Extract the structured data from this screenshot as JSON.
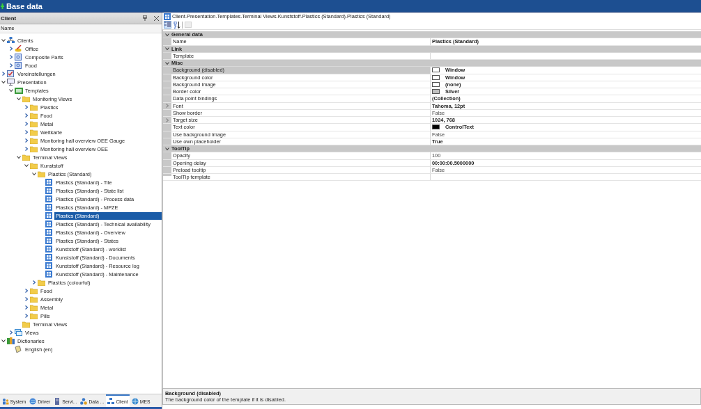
{
  "window": {
    "title": "Base data"
  },
  "left_panel": {
    "title": "Client",
    "column_header": "Name",
    "tree": [
      {
        "label": "Clients",
        "kind": "group",
        "expanded": true,
        "selected": false,
        "children": [
          {
            "label": "Office",
            "kind": "office",
            "expanded": false,
            "selected": false
          },
          {
            "label": "Composite Parts",
            "kind": "part",
            "expanded": false,
            "selected": false
          },
          {
            "label": "Food",
            "kind": "part",
            "expanded": false,
            "selected": false
          }
        ]
      },
      {
        "label": "Voreinstellungen",
        "kind": "settings",
        "expanded": false,
        "selected": false
      },
      {
        "label": "Presentation",
        "kind": "presentation",
        "expanded": true,
        "selected": false,
        "children": [
          {
            "label": "Templates",
            "kind": "templates",
            "expanded": true,
            "selected": false,
            "children": [
              {
                "label": "Monitoring Views",
                "kind": "folder",
                "expanded": true,
                "selected": false,
                "children": [
                  {
                    "label": "Plastics",
                    "kind": "folder",
                    "expanded": false,
                    "selected": false
                  },
                  {
                    "label": "Food",
                    "kind": "folder",
                    "expanded": false,
                    "selected": false
                  },
                  {
                    "label": "Metal",
                    "kind": "folder",
                    "expanded": false,
                    "selected": false
                  },
                  {
                    "label": "Weltkarte",
                    "kind": "folder",
                    "expanded": false,
                    "selected": false
                  },
                  {
                    "label": "Monitoring hall overview OEE Gauge",
                    "kind": "folder",
                    "expanded": false,
                    "selected": false
                  },
                  {
                    "label": "Monitoring hall overview OEE",
                    "kind": "folder",
                    "expanded": false,
                    "selected": false
                  }
                ]
              },
              {
                "label": "Terminal Views",
                "kind": "folder",
                "expanded": true,
                "selected": false,
                "children": [
                  {
                    "label": "Kunststoff",
                    "kind": "folder",
                    "expanded": true,
                    "selected": false,
                    "children": [
                      {
                        "label": "Plastics (Standard)",
                        "kind": "folder",
                        "expanded": true,
                        "selected": false,
                        "children": [
                          {
                            "label": "Plastics (Standard) - Tile",
                            "kind": "view",
                            "selected": false
                          },
                          {
                            "label": "Plastics (Standard) - State list",
                            "kind": "view",
                            "selected": false
                          },
                          {
                            "label": "Plastics (Standard) - Process data",
                            "kind": "view",
                            "selected": false
                          },
                          {
                            "label": "Plastics (Standard) - MPZE",
                            "kind": "view",
                            "selected": false
                          },
                          {
                            "label": "Plastics (Standard)",
                            "kind": "view",
                            "selected": true
                          },
                          {
                            "label": "Plastics (Standard) - Technical availability",
                            "kind": "view",
                            "selected": false
                          },
                          {
                            "label": "Plastics (Standard) - Overview",
                            "kind": "view",
                            "selected": false
                          },
                          {
                            "label": "Plastics (Standard) - States",
                            "kind": "view",
                            "selected": false
                          },
                          {
                            "label": "Kunststoff (Standard) - worklist",
                            "kind": "view",
                            "selected": false
                          },
                          {
                            "label": "Kunststoff (Standard) - Documents",
                            "kind": "view",
                            "selected": false
                          },
                          {
                            "label": "Kunststoff (Standard) - Resource log",
                            "kind": "view",
                            "selected": false
                          },
                          {
                            "label": "Kunststoff (Standard) - Maintenance",
                            "kind": "view",
                            "selected": false
                          }
                        ]
                      },
                      {
                        "label": "Plastics (colourful)",
                        "kind": "folder",
                        "expanded": false,
                        "selected": false
                      }
                    ]
                  },
                  {
                    "label": "Food",
                    "kind": "folder",
                    "expanded": false,
                    "selected": false
                  },
                  {
                    "label": "Assembly",
                    "kind": "folder",
                    "expanded": false,
                    "selected": false
                  },
                  {
                    "label": "Metal",
                    "kind": "folder",
                    "expanded": false,
                    "selected": false
                  },
                  {
                    "label": "Pills",
                    "kind": "folder",
                    "expanded": false,
                    "selected": false
                  }
                ]
              },
              {
                "label": "Terminal Views",
                "kind": "folder",
                "selected": false
              }
            ]
          },
          {
            "label": "Views",
            "kind": "views",
            "expanded": false,
            "selected": false
          }
        ]
      },
      {
        "label": "Dictionaries",
        "kind": "dictionary",
        "expanded": true,
        "selected": false,
        "children": [
          {
            "label": "English (en)",
            "kind": "language",
            "selected": false
          }
        ]
      }
    ],
    "tabs": [
      {
        "label": "System",
        "kind": "system",
        "selected": false
      },
      {
        "label": "Driver",
        "kind": "driver",
        "selected": false
      },
      {
        "label": "Servi...",
        "kind": "service",
        "selected": false
      },
      {
        "label": "Data ...",
        "kind": "data",
        "selected": false
      },
      {
        "label": "Client",
        "kind": "client",
        "selected": true
      },
      {
        "label": "MES",
        "kind": "mes",
        "selected": false
      }
    ]
  },
  "right_panel": {
    "path": "Client.Presentation.Templates.Terminal Views.Kunststoff.Plastics (Standard).Plastics (Standard)",
    "toolbar": [
      {
        "kind": "categorized",
        "on": true,
        "disabled": false
      },
      {
        "kind": "alphabetical",
        "on": false,
        "disabled": false
      },
      {
        "kind": "pages",
        "on": false,
        "disabled": true
      }
    ],
    "categories": [
      {
        "label": "General data",
        "expanded": true,
        "rows": [
          {
            "name": "Name",
            "value": "Plastics (Standard)",
            "modified": true,
            "selected": false
          }
        ]
      },
      {
        "label": "Link",
        "expanded": true,
        "rows": [
          {
            "name": "Template",
            "selected": false
          }
        ]
      },
      {
        "label": "Misc",
        "expanded": true,
        "rows": [
          {
            "name": "Background (disabled)",
            "value": "Window",
            "modified": true,
            "color": "#ffffff",
            "selected": true
          },
          {
            "name": "Background color",
            "value": "Window",
            "modified": true,
            "color": "#ffffff",
            "selected": false
          },
          {
            "name": "Background image",
            "value": "(none)",
            "modified": true,
            "color": "#ffffff",
            "selected": false
          },
          {
            "name": "Border color",
            "value": "Silver",
            "modified": true,
            "color": "#c0c0c0",
            "selected": false
          },
          {
            "name": "Data point bindings",
            "value": "(Collection)",
            "modified": true,
            "selected": false
          },
          {
            "name": "Font",
            "value": "Tahoma, 12pt",
            "modified": true,
            "expanded": false,
            "selected": false
          },
          {
            "name": "Show border",
            "value": "False",
            "modified": false,
            "selected": false
          },
          {
            "name": "Target size",
            "value": "1024, 768",
            "modified": true,
            "expanded": false,
            "selected": false
          },
          {
            "name": "Text color",
            "value": "ControlText",
            "modified": true,
            "color": "#000000",
            "selected": false
          },
          {
            "name": "Use background image",
            "value": "False",
            "modified": false,
            "selected": false
          },
          {
            "name": "Use own placeholder",
            "value": "True",
            "modified": true,
            "selected": false
          }
        ]
      },
      {
        "label": "ToolTip",
        "expanded": true,
        "rows": [
          {
            "name": "Opacity",
            "value": "100",
            "modified": false,
            "selected": false
          },
          {
            "name": "Opening delay",
            "value": "00:00:00.5000000",
            "modified": true,
            "selected": false
          },
          {
            "name": "Preload tooltip",
            "value": "False",
            "modified": false,
            "selected": false
          },
          {
            "name": "ToolTip template",
            "selected": false
          }
        ]
      }
    ],
    "description": {
      "title": "Background (disabled)",
      "text": "The background color of the template if it is disabled."
    }
  }
}
